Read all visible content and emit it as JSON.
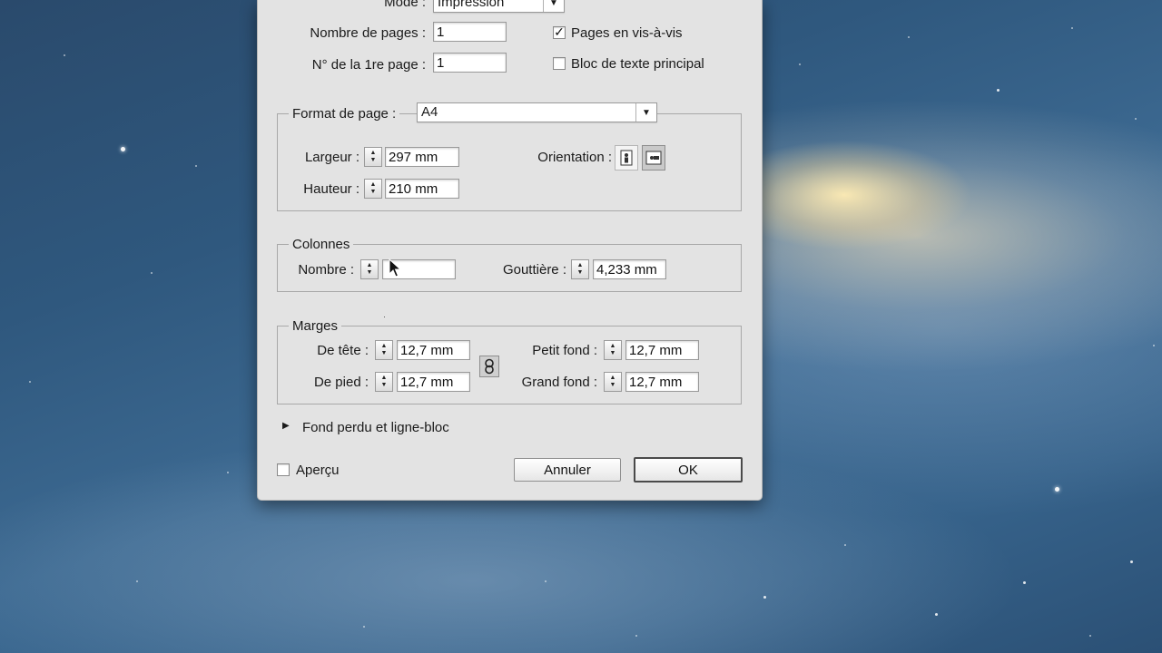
{
  "document_setup": {
    "mode_label": "Mode :",
    "mode_value": "Impression",
    "page_count_label": "Nombre de pages :",
    "page_count_value": "1",
    "first_page_label": "N° de la 1re page :",
    "first_page_value": "1",
    "facing_pages_label": "Pages en vis-à-vis",
    "facing_pages_checked": true,
    "primary_text_frame_label": "Bloc de texte principal",
    "primary_text_frame_checked": false
  },
  "page_format": {
    "legend": "Format de page :",
    "size_value": "A4",
    "width_label": "Largeur :",
    "width_value": "297 mm",
    "height_label": "Hauteur :",
    "height_value": "210 mm",
    "orientation_label": "Orientation :",
    "orientation_selected": "landscape"
  },
  "columns": {
    "legend": "Colonnes",
    "number_label": "Nombre :",
    "number_value": "",
    "gutter_label": "Gouttière :",
    "gutter_value": "4,233 mm"
  },
  "margins": {
    "legend": "Marges",
    "top_label": "De tête :",
    "top_value": "12,7 mm",
    "bottom_label": "De pied :",
    "bottom_value": "12,7 mm",
    "inside_label": "Petit fond :",
    "inside_value": "12,7 mm",
    "outside_label": "Grand fond :",
    "outside_value": "12,7 mm"
  },
  "bleed_section": {
    "label": "Fond perdu et ligne-bloc",
    "expanded": false
  },
  "footer": {
    "preview_label": "Aperçu",
    "preview_checked": false,
    "cancel_label": "Annuler",
    "ok_label": "OK"
  },
  "icons": {
    "spinner": "stepper-arrows-icon",
    "portrait": "portrait-orientation-icon",
    "landscape": "landscape-orientation-icon",
    "chain": "chain-link-icon",
    "disclosure": "disclosure-triangle-icon",
    "cursor": "mouse-pointer-icon"
  }
}
